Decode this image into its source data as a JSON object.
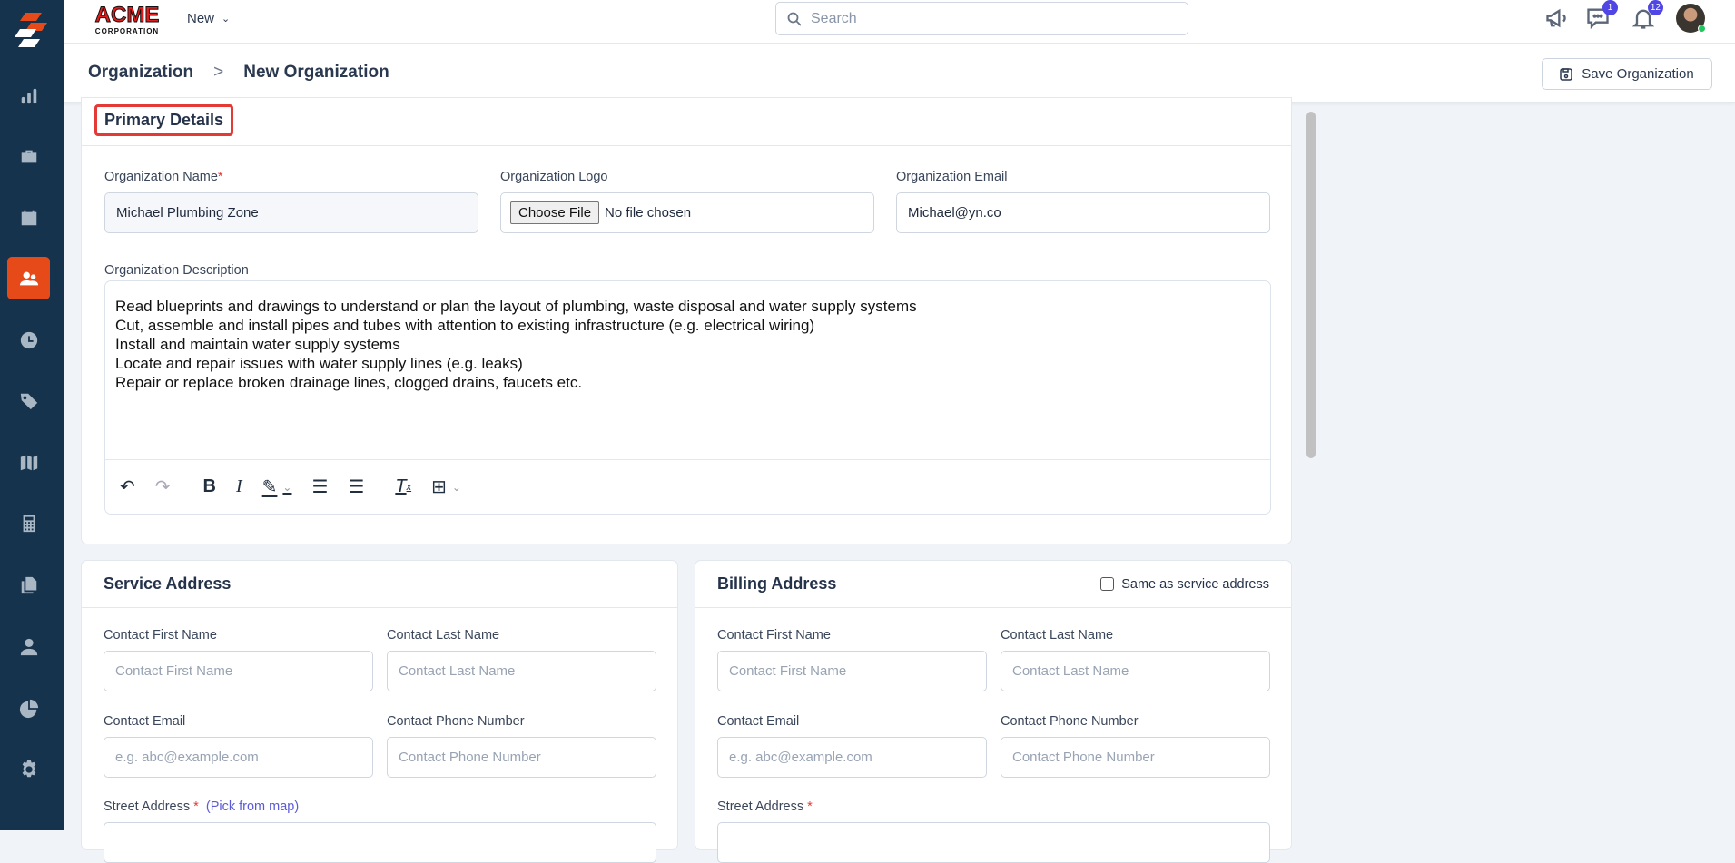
{
  "topbar": {
    "brand_top": "ACME",
    "brand_bottom": "CORPORATION",
    "new_label": "New",
    "search_placeholder": "Search",
    "messages_badge": "1",
    "notifications_badge": "12"
  },
  "breadcrumb": {
    "parent": "Organization",
    "separator": ">",
    "current": "New Organization"
  },
  "actions": {
    "save_label": "Save Organization"
  },
  "primary": {
    "title": "Primary Details",
    "name_label": "Organization Name",
    "name_value": "Michael Plumbing Zone",
    "logo_label": "Organization Logo",
    "choose_file": "Choose File",
    "no_file": "No file chosen",
    "email_label": "Organization Email",
    "email_value": "Michael@yn.co",
    "desc_label": "Organization Description",
    "desc_value": "Read blueprints and drawings to understand or plan the layout of plumbing, waste disposal and water supply systems\nCut, assemble and install pipes and tubes with attention to existing infrastructure (e.g. electrical wiring)\nInstall and maintain water supply systems\nLocate and repair issues with water supply lines (e.g. leaks)\nRepair or replace broken drainage lines, clogged drains, faucets etc."
  },
  "service": {
    "title": "Service Address",
    "first_label": "Contact First Name",
    "first_ph": "Contact First Name",
    "last_label": "Contact Last Name",
    "last_ph": "Contact Last Name",
    "email_label": "Contact Email",
    "email_ph": "e.g. abc@example.com",
    "phone_label": "Contact Phone Number",
    "phone_ph": "Contact Phone Number",
    "street_label": "Street Address",
    "pick_map": "(Pick from map)"
  },
  "billing": {
    "title": "Billing Address",
    "same_as": "Same as service address",
    "first_label": "Contact First Name",
    "first_ph": "Contact First Name",
    "last_label": "Contact Last Name",
    "last_ph": "Contact Last Name",
    "email_label": "Contact Email",
    "email_ph": "e.g. abc@example.com",
    "phone_label": "Contact Phone Number",
    "phone_ph": "Contact Phone Number",
    "street_label": "Street Address"
  },
  "colors": {
    "sidebar": "#15334c",
    "active": "#e64a19",
    "badge": "#4f46e5"
  }
}
